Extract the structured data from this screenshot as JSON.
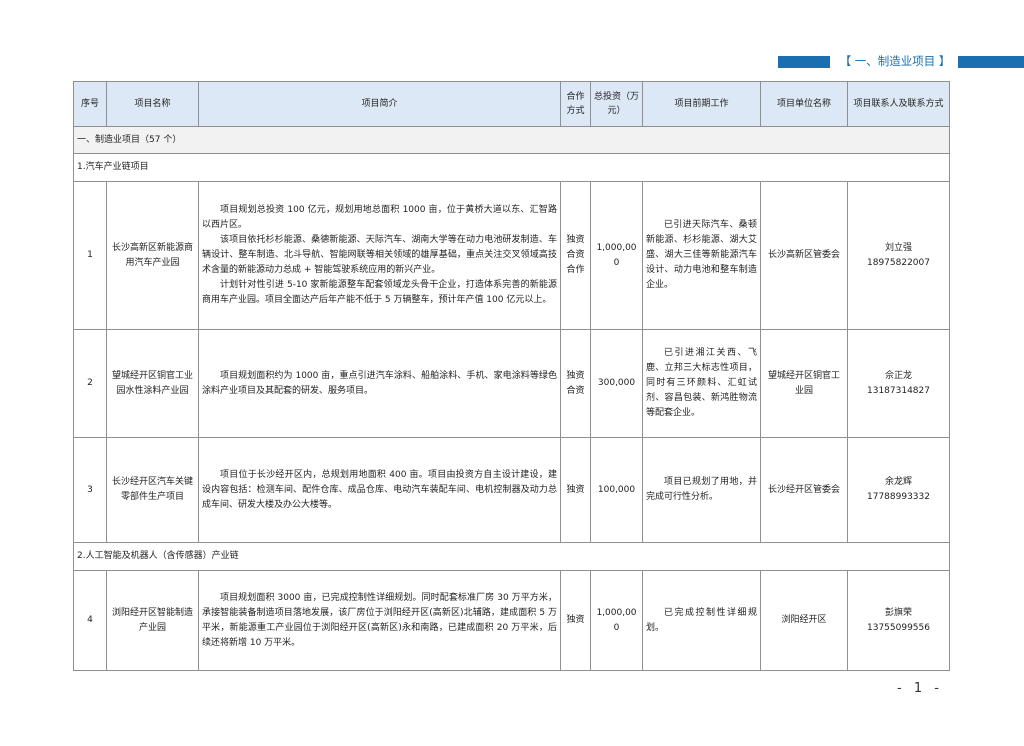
{
  "banner": {
    "title": "【 一、制造业项目 】",
    "color": "#1a6fb0"
  },
  "headers": {
    "seq": "序号",
    "name": "项目名称",
    "intro": "项目简介",
    "coop": "合作方式",
    "invest": "总投资（万元）",
    "prep": "项目前期工作",
    "unit": "项目单位名称",
    "contact": "项目联系人及联系方式"
  },
  "section1": "一、制造业项目（57 个）",
  "chain1": "1.汽车产业链项目",
  "chain2": "2.人工智能及机器人（含传感器）产业链",
  "rows": [
    {
      "seq": "1",
      "name": "长沙高新区新能源商用汽车产业园",
      "intro": [
        "项目规划总投资 100 亿元，规划用地总面积 1000 亩，位于黄桥大道以东、汇智路以西片区。",
        "该项目依托杉杉能源、桑德新能源、天际汽车、湖南大学等在动力电池研发制造、车辆设计、整车制造、北斗导航、智能网联等相关领域的雄厚基础，重点关注交叉领域高技术含量的新能源动力总成 + 智能驾驶系统应用的新兴产业。",
        "计划针对性引进 5-10 家新能源整车配套领域龙头骨干企业，打造体系完善的新能源商用车产业园。项目全面达产后年产能不低于 5 万辆整车，预计年产值 100 亿元以上。"
      ],
      "coop": "独资合资合作",
      "invest": "1,000,000",
      "prep": "已引进天际汽车、桑顿新能源、杉杉能源、湖大艾盛、湖大三佳等新能源汽车设计、动力电池和整车制造企业。",
      "unit": "长沙高新区管委会",
      "contact_name": "刘立强",
      "contact_phone": "18975822007"
    },
    {
      "seq": "2",
      "name": "望城经开区铜官工业园水性涂料产业园",
      "intro": [
        "项目规划面积约为 1000 亩，重点引进汽车涂料、船舶涂料、手机、家电涂料等绿色涂料产业项目及其配套的研发、服务项目。"
      ],
      "coop": "独资合资",
      "invest": "300,000",
      "prep": "已引进湘江关西、飞鹿、立邦三大标志性项目，同时有三环颜料、汇虹试剂、容昌包装、新鸿胜物流等配套企业。",
      "unit": "望城经开区铜官工业园",
      "contact_name": "佘正龙",
      "contact_phone": "13187314827"
    },
    {
      "seq": "3",
      "name": "长沙经开区汽车关键零部件生产项目",
      "intro": [
        "项目位于长沙经开区内，总规划用地面积 400 亩。项目由投资方自主设计建设，建设内容包括：检测车间、配件仓库、成品仓库、电动汽车装配车间、电机控制器及动力总成车间、研发大楼及办公大楼等。"
      ],
      "coop": "独资",
      "invest": "100,000",
      "prep": "项目已规划了用地，并完成可行性分析。",
      "unit": "长沙经开区管委会",
      "contact_name": "余龙辉",
      "contact_phone": "17788993332"
    },
    {
      "seq": "4",
      "name": "浏阳经开区智能制造产业园",
      "intro": [
        "项目规划面积 3000 亩，已完成控制性详细规划。同时配套标准厂房 30 万平方米，承接智能装备制造项目落地发展，该厂房位于浏阳经开区(高新区)北辅路，建成面积 5 万平米，新能源重工产业园位于浏阳经开区(高新区)永和南路，已建成面积 20 万平米，后续还将新增 10 万平米。"
      ],
      "coop": "独资",
      "invest": "1,000,000",
      "prep": "已完成控制性详细规划。",
      "unit": "浏阳经开区",
      "contact_name": "彭旗荣",
      "contact_phone": "13755099556"
    }
  ],
  "page_number": "- 1 -"
}
